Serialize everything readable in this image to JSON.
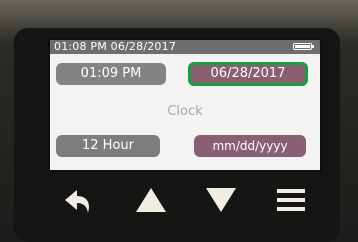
{
  "status_bar": {
    "datetime": "01:08 PM 06/28/2017",
    "battery_icon": "battery-full-icon",
    "battery_level": 1.0
  },
  "time_button": {
    "label": "01:09 PM"
  },
  "date_button": {
    "label": "06/28/2017",
    "selected": true
  },
  "screen_title": "Clock",
  "hour_format_button": {
    "label": "12 Hour"
  },
  "date_format_button": {
    "label": "mm/dd/yyyy"
  },
  "hardware_buttons": [
    {
      "icon": "back-arrow-icon"
    },
    {
      "icon": "up-triangle-icon"
    },
    {
      "icon": "down-triangle-icon"
    },
    {
      "icon": "menu-icon"
    }
  ],
  "colors": {
    "status_bar": "#6e6d70",
    "time_button": "#848283",
    "date_button": "#8a5f74",
    "selection_outline": "#18a03c",
    "hour_format_button": "#7f7c80",
    "date_format_button": "#8a5f74",
    "screen_background": "#f3f3f1",
    "hardware_icon": "#f2ece2"
  }
}
